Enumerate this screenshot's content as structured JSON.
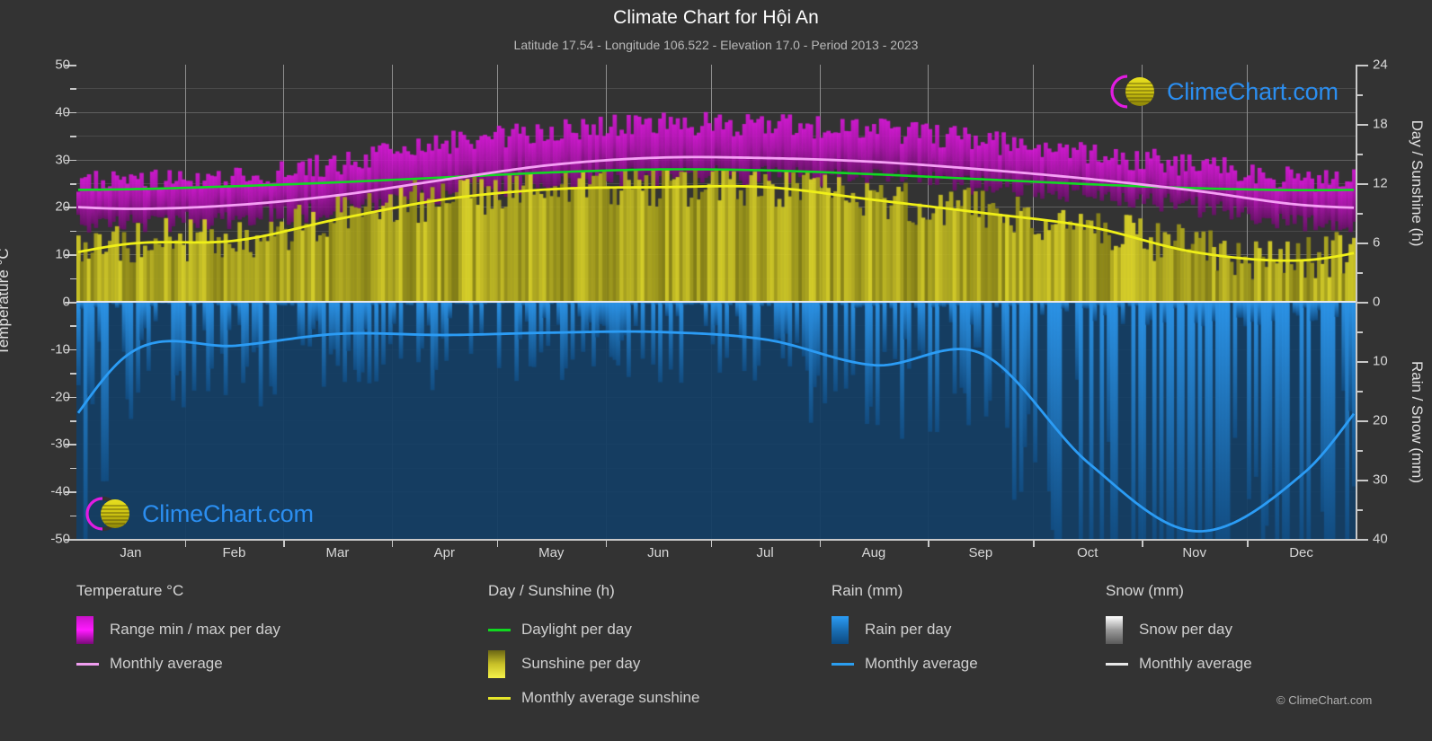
{
  "header": {
    "title": "Climate Chart for Hội An",
    "subtitle": "Latitude 17.54 - Longitude 106.522 - Elevation 17.0 - Period 2013 - 2023"
  },
  "watermark": {
    "text": "ClimeChart.com"
  },
  "footer": {
    "copyright": "© ClimeChart.com"
  },
  "axes": {
    "left_title": "Temperature °C",
    "right_title_top": "Day / Sunshine (h)",
    "right_title_bottom": "Rain / Snow (mm)",
    "left_ticks": [
      "50",
      "40",
      "30",
      "20",
      "10",
      "0",
      "-10",
      "-20",
      "-30",
      "-40",
      "-50"
    ],
    "right_ticks_top": [
      "24",
      "18",
      "12",
      "6",
      "0"
    ],
    "right_ticks_bottom": [
      "0",
      "10",
      "20",
      "30",
      "40"
    ],
    "x_ticks": [
      "Jan",
      "Feb",
      "Mar",
      "Apr",
      "May",
      "Jun",
      "Jul",
      "Aug",
      "Sep",
      "Oct",
      "Nov",
      "Dec"
    ]
  },
  "legend": {
    "columns": [
      {
        "title": "Temperature °C",
        "items": [
          {
            "label": "Range min / max per day",
            "marker": "box",
            "color": "#e810e8"
          },
          {
            "label": "Monthly average",
            "marker": "line",
            "color": "#f09ef0"
          }
        ]
      },
      {
        "title": "Day / Sunshine (h)",
        "items": [
          {
            "label": "Daylight per day",
            "marker": "line",
            "color": "#10d820"
          },
          {
            "label": "Sunshine per day",
            "marker": "box",
            "color": "#eded35"
          },
          {
            "label": "Monthly average sunshine",
            "marker": "line",
            "color": "#e6e62a"
          }
        ]
      },
      {
        "title": "Rain (mm)",
        "items": [
          {
            "label": "Rain per day",
            "marker": "box",
            "color": "#1e8ae0"
          },
          {
            "label": "Monthly average",
            "marker": "line",
            "color": "#2b9ef0"
          }
        ]
      },
      {
        "title": "Snow (mm)",
        "items": [
          {
            "label": "Snow per day",
            "marker": "box",
            "color": "#dedede"
          },
          {
            "label": "Monthly average",
            "marker": "line",
            "color": "#e8e8e8"
          }
        ]
      }
    ]
  },
  "colors": {
    "background": "#333333",
    "grid": "#5e5e5e",
    "axis": "#c9c9c9",
    "temp_range": "#cc18cc",
    "temp_avg": "#f5a0f5",
    "daylight": "#12d823",
    "sunshine_band": "#b4b42a",
    "sunshine_avg": "#efef18",
    "rain_band": "#1565a8",
    "rain_avg": "#2b9cf5",
    "logo_text": "#2b8ef0",
    "logo_crescent": "#e21ce2",
    "logo_sphere": "#d8d018"
  },
  "chart_data": {
    "type": "line",
    "title": "Climate Chart for Hội An",
    "subtitle": "Latitude 17.54 - Longitude 106.522 - Elevation 17.0 - Period 2013 - 2023",
    "xlabel": "",
    "ylabel": "Temperature °C",
    "ylim": [
      -50,
      50
    ],
    "y2lim_top": [
      0,
      24
    ],
    "y2lim_bottom": [
      0,
      40
    ],
    "grid": true,
    "legend_position": "below",
    "categories": [
      "Jan",
      "Feb",
      "Mar",
      "Apr",
      "May",
      "Jun",
      "Jul",
      "Aug",
      "Sep",
      "Oct",
      "Nov",
      "Dec"
    ],
    "series": [
      {
        "name": "Monthly average temperature",
        "unit": "°C",
        "axis": "left",
        "color": "#f5a0f5",
        "values": [
          19.6,
          20.4,
          22.5,
          25.8,
          28.9,
          30.4,
          30.3,
          29.5,
          27.9,
          25.9,
          23.4,
          20.4
        ]
      },
      {
        "name": "Daily max temperature (range top)",
        "unit": "°C",
        "axis": "left",
        "color": "#cc18cc",
        "values": [
          24.5,
          25.5,
          28.5,
          32.5,
          35.5,
          36.5,
          36.5,
          35.5,
          33.0,
          30.5,
          28.0,
          25.0
        ]
      },
      {
        "name": "Daily min temperature (range bottom)",
        "unit": "°C",
        "axis": "left",
        "color": "#cc18cc",
        "values": [
          16.5,
          17.5,
          19.5,
          22.5,
          25.0,
          26.5,
          26.5,
          26.0,
          24.5,
          22.5,
          20.0,
          17.0
        ]
      },
      {
        "name": "Daylight per day",
        "unit": "h",
        "axis": "right_top",
        "color": "#12d823",
        "values": [
          11.4,
          11.7,
          12.1,
          12.6,
          13.1,
          13.4,
          13.3,
          12.9,
          12.4,
          11.9,
          11.5,
          11.3
        ]
      },
      {
        "name": "Monthly average sunshine",
        "unit": "h",
        "axis": "right_top",
        "color": "#efef18",
        "values": [
          5.9,
          6.2,
          8.4,
          10.4,
          11.4,
          11.6,
          11.6,
          10.3,
          9.0,
          7.6,
          5.0,
          4.2
        ]
      },
      {
        "name": "Monthly average rain",
        "unit": "mm",
        "axis": "right_bottom",
        "color": "#2b9cf5",
        "values": [
          8.4,
          7.4,
          5.4,
          5.6,
          5.2,
          5.1,
          6.4,
          10.7,
          8.8,
          27.3,
          38.7,
          29.0
        ]
      },
      {
        "name": "Monthly average snow",
        "unit": "mm",
        "axis": "right_bottom",
        "color": "#e8e8e8",
        "values": [
          0,
          0,
          0,
          0,
          0,
          0,
          0,
          0,
          0,
          0,
          0,
          0
        ]
      }
    ]
  }
}
